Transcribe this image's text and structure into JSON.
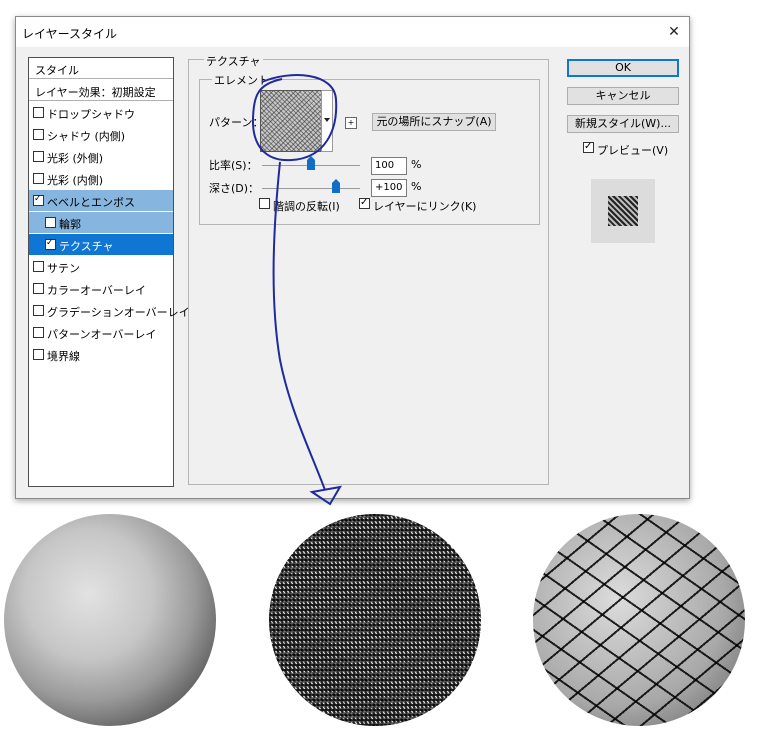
{
  "window": {
    "title": "レイヤースタイル",
    "close_glyph": "✕"
  },
  "sidebar": {
    "header": "スタイル",
    "blend": "レイヤー効果：初期設定",
    "items": [
      {
        "label": "ドロップシャドウ",
        "checked": false
      },
      {
        "label": "シャドウ (内側)",
        "checked": false
      },
      {
        "label": "光彩 (外側)",
        "checked": false
      },
      {
        "label": "光彩 (内側)",
        "checked": false
      },
      {
        "label": "ベベルとエンボス",
        "checked": true
      },
      {
        "label": "輪郭",
        "checked": false
      },
      {
        "label": "テクスチャ",
        "checked": true
      },
      {
        "label": "サテン",
        "checked": false
      },
      {
        "label": "カラーオーバーレイ",
        "checked": false
      },
      {
        "label": "グラデーションオーバーレイ",
        "checked": false
      },
      {
        "label": "パターンオーバーレイ",
        "checked": false
      },
      {
        "label": "境界線",
        "checked": false
      }
    ]
  },
  "texture": {
    "group_title": "テクスチャ",
    "element_title": "エレメント",
    "pattern_label": "パターン：",
    "snap_button": "元の場所にスナップ(A)",
    "scale_label": "比率(S)：",
    "scale_value": "100",
    "scale_unit": "%",
    "scale_level": 0.5,
    "depth_label": "深さ(D)：",
    "depth_value": "+100",
    "depth_unit": "%",
    "depth_level": 0.75,
    "invert_label": "階調の反転(I)",
    "invert_checked": false,
    "link_label": "レイヤーにリンク(K)",
    "link_checked": true
  },
  "buttons": {
    "ok": "OK",
    "cancel": "キャンセル",
    "new_style": "新規スタイル(W)...",
    "preview_label": "プレビュー(V)",
    "preview_checked": true
  },
  "colors": {
    "selection_light": "#86b6e0",
    "selection_dark": "#0f77d3",
    "annotation": "#1f2a9e"
  }
}
